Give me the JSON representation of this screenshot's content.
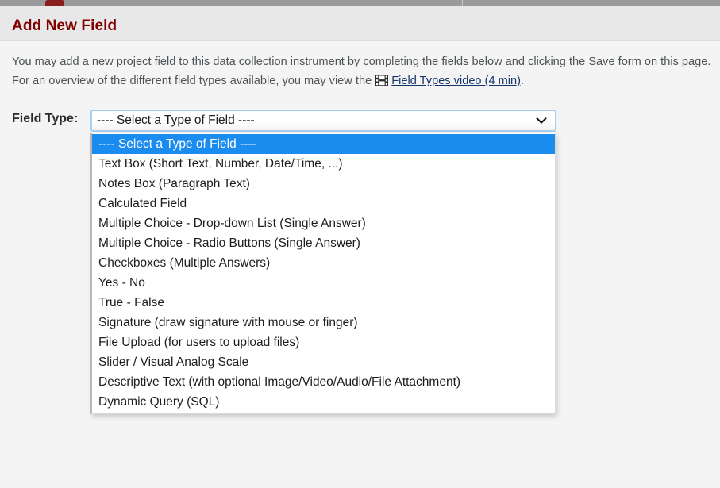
{
  "browser": {
    "active_tab_color": "#8c1d1d",
    "strip_color": "#9b9b9b"
  },
  "header": {
    "title": "Add New Field",
    "title_color": "#800000",
    "band_color": "#e8e8e8"
  },
  "instructions": {
    "part1": "You may add a new project field to this data collection instrument by completing the fields below and clicking the Save form on this page. For an overview of the different field types available, you may view the ",
    "video_icon": "video-icon",
    "link_text": "Field Types video (4 min)",
    "link_color": "#15366b",
    "part2": "."
  },
  "field_type": {
    "label": "Field Type:",
    "selected_value": "---- Select a Type of Field ----",
    "arrow_icon": "chevron-down-icon",
    "focus_border_color": "#a8cef0",
    "highlight_color": "#1a8cf0",
    "options": [
      "---- Select a Type of Field ----",
      "Text Box (Short Text, Number, Date/Time, ...)",
      "Notes Box (Paragraph Text)",
      "Calculated Field",
      "Multiple Choice - Drop-down List (Single Answer)",
      "Multiple Choice - Radio Buttons (Single Answer)",
      "Checkboxes (Multiple Answers)",
      "Yes - No",
      "True - False",
      "Signature (draw signature with mouse or finger)",
      "File Upload (for users to upload files)",
      "Slider / Visual Analog Scale",
      "Descriptive Text (with optional Image/Video/Audio/File Attachment)",
      "Dynamic Query (SQL)"
    ],
    "selected_index": 0
  }
}
